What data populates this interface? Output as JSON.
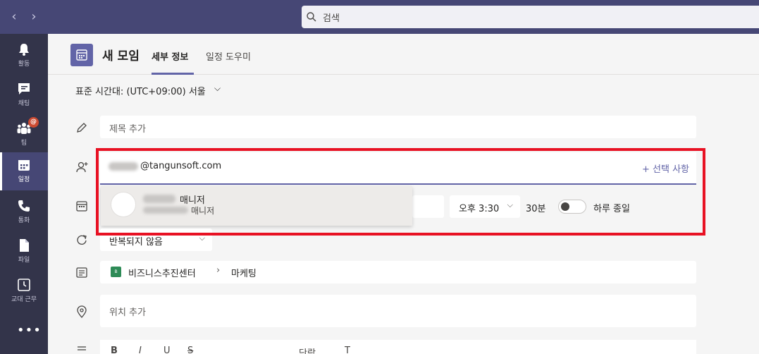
{
  "search": {
    "placeholder": "검색"
  },
  "rail": {
    "items": [
      {
        "label": "활동"
      },
      {
        "label": "채팅"
      },
      {
        "label": "팀",
        "badge": "@"
      },
      {
        "label": "일정"
      },
      {
        "label": "통화"
      },
      {
        "label": "파일"
      },
      {
        "label": "교대 근무"
      }
    ],
    "more": "•••"
  },
  "header": {
    "title": "새 모임",
    "tabs": [
      {
        "label": "세부 정보"
      },
      {
        "label": "일정 도우미"
      }
    ]
  },
  "timezone": {
    "label": "표준 시간대: (UTC+09:00) 서울"
  },
  "form": {
    "title_placeholder": "제목 추가",
    "attendee": {
      "typed": "@tangunsoft.com",
      "options_link": "+ 선택 사항"
    },
    "suggestion": {
      "name_suffix": "매니저",
      "role_suffix": "매니저"
    },
    "time": "오후 3:30",
    "duration": "30분",
    "all_day": "하루 종일",
    "repeat": "반복되지 않음",
    "team_icon_text": "B",
    "team": "비즈니스추진센터",
    "channel": "마케팅",
    "location_placeholder": "위치 추가"
  },
  "toolbar": {
    "bold": "B",
    "italic": "I",
    "underline": "U",
    "strike": "S",
    "para": "단락",
    "text": "T"
  },
  "colors": {
    "accent": "#6264a7",
    "highlight": "#e81123",
    "topbar": "#464775",
    "rail": "#33344a"
  }
}
